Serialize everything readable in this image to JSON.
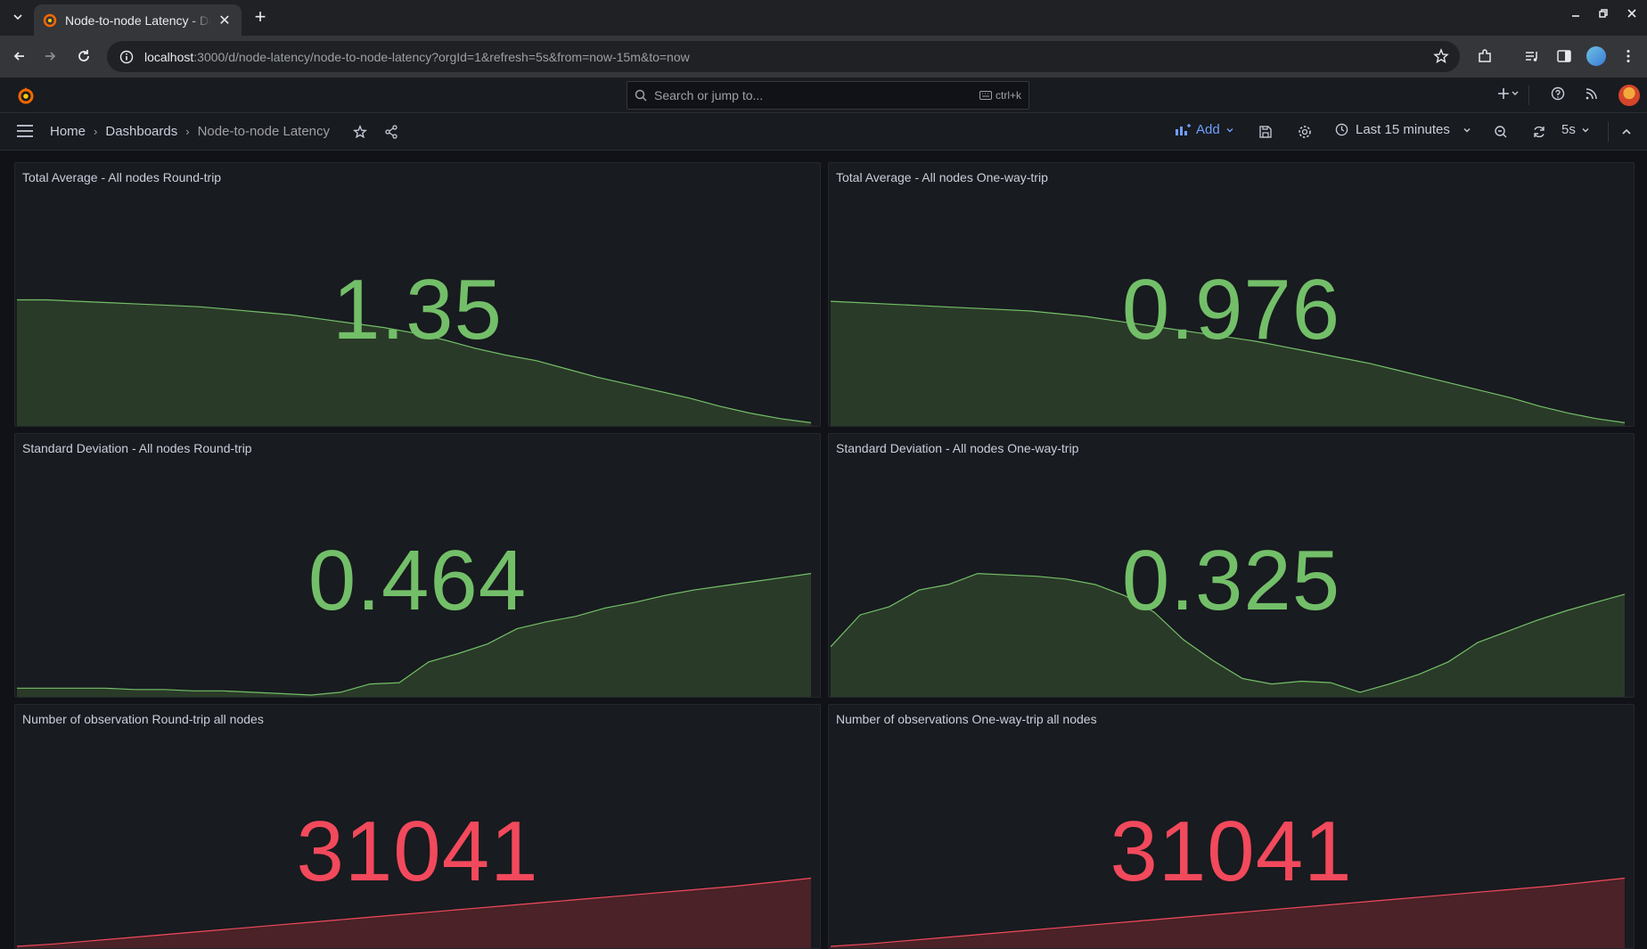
{
  "browser": {
    "tab_title": "Node-to-node Latency - Dashboards - Grafana",
    "url_host": "localhost",
    "url_rest": ":3000/d/node-latency/node-to-node-latency?orgId=1&refresh=5s&from=now-15m&to=now"
  },
  "grafana": {
    "search_placeholder": "Search or jump to...",
    "search_shortcut": "ctrl+k",
    "breadcrumb": [
      "Home",
      "Dashboards",
      "Node-to-node Latency"
    ],
    "add_label": "Add",
    "time_range": "Last 15 minutes",
    "refresh_interval": "5s"
  },
  "colors": {
    "ok": "#73bf69",
    "ok_fill": "#2a3a28",
    "bad": "#f2495c",
    "bad_fill": "#4a2227"
  },
  "panels": [
    {
      "title": "Total Average - All nodes Round-trip",
      "value": "1.35",
      "status": "ok",
      "spark": [
        0.9,
        0.9,
        0.89,
        0.88,
        0.87,
        0.86,
        0.85,
        0.83,
        0.81,
        0.79,
        0.76,
        0.73,
        0.7,
        0.66,
        0.61,
        0.55,
        0.5,
        0.46,
        0.4,
        0.34,
        0.29,
        0.24,
        0.19,
        0.13,
        0.08,
        0.04,
        0.01
      ]
    },
    {
      "title": "Total Average - All nodes One-way-trip",
      "value": "0.976",
      "status": "ok",
      "spark": [
        0.89,
        0.88,
        0.87,
        0.86,
        0.85,
        0.84,
        0.83,
        0.82,
        0.8,
        0.78,
        0.75,
        0.72,
        0.69,
        0.66,
        0.63,
        0.6,
        0.56,
        0.52,
        0.48,
        0.44,
        0.39,
        0.34,
        0.29,
        0.24,
        0.19,
        0.13,
        0.08,
        0.04,
        0.01
      ]
    },
    {
      "title": "Standard Deviation - All nodes Round-trip",
      "value": "0.464",
      "status": "ok",
      "spark": [
        0.05,
        0.05,
        0.05,
        0.05,
        0.04,
        0.04,
        0.03,
        0.03,
        0.02,
        0.01,
        0.0,
        0.02,
        0.08,
        0.09,
        0.24,
        0.3,
        0.37,
        0.48,
        0.53,
        0.57,
        0.63,
        0.67,
        0.72,
        0.76,
        0.79,
        0.82,
        0.85,
        0.88
      ]
    },
    {
      "title": "Standard Deviation - All nodes One-way-trip",
      "value": "0.325",
      "status": "ok",
      "spark": [
        0.35,
        0.58,
        0.64,
        0.76,
        0.8,
        0.88,
        0.87,
        0.86,
        0.84,
        0.8,
        0.72,
        0.6,
        0.4,
        0.25,
        0.12,
        0.08,
        0.1,
        0.09,
        0.02,
        0.08,
        0.15,
        0.24,
        0.38,
        0.46,
        0.54,
        0.61,
        0.67,
        0.73
      ]
    },
    {
      "title": "Number of observation Round-trip all nodes",
      "value": "31041",
      "status": "bad",
      "spark": [
        0.0,
        0.03,
        0.07,
        0.11,
        0.15,
        0.19,
        0.23,
        0.27,
        0.31,
        0.35,
        0.39,
        0.43,
        0.47,
        0.51,
        0.55,
        0.59,
        0.63,
        0.67,
        0.71,
        0.75,
        0.8,
        0.85
      ]
    },
    {
      "title": "Number of observations One-way-trip all nodes",
      "value": "31041",
      "status": "bad",
      "spark": [
        0.0,
        0.03,
        0.07,
        0.11,
        0.15,
        0.19,
        0.23,
        0.27,
        0.31,
        0.35,
        0.39,
        0.43,
        0.47,
        0.51,
        0.55,
        0.59,
        0.63,
        0.67,
        0.71,
        0.75,
        0.8,
        0.85
      ]
    }
  ]
}
